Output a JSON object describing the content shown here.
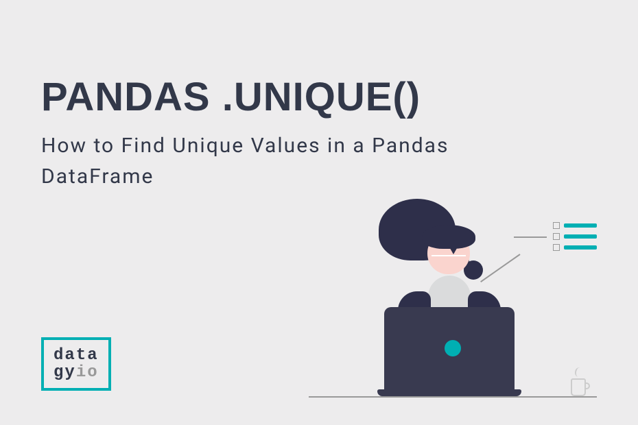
{
  "title": "PANDAS .UNIQUE()",
  "subtitle": "How to Find Unique Values in a Pandas DataFrame",
  "logo": {
    "line1_part1": "data",
    "line2_part1": "gy",
    "line2_part2": "io"
  },
  "colors": {
    "accent": "#00afb3",
    "dark": "#323849",
    "illustration_dark": "#2e2f4a",
    "background": "#edeced",
    "skin": "#fad4ce"
  }
}
